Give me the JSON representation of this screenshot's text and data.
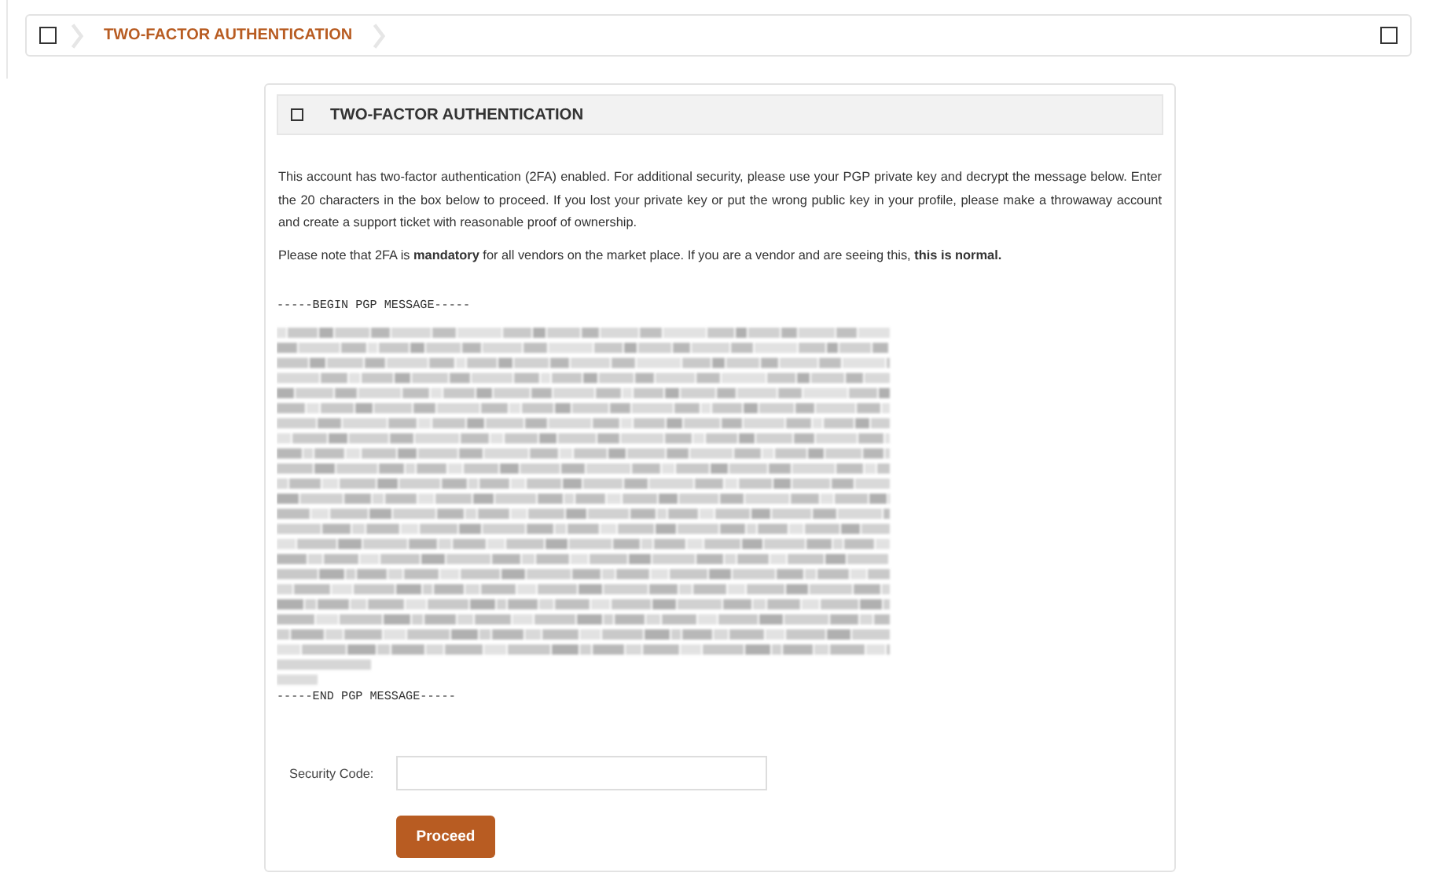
{
  "breadcrumb": {
    "items": [
      {
        "label": "TWO-FACTOR AUTHENTICATION",
        "selected": true
      }
    ]
  },
  "panel": {
    "title": "TWO-FACTOR AUTHENTICATION",
    "paragraphs": [
      "This account has two-factor authentication (2FA) enabled. For additional security, please use your PGP private key and decrypt the message below. Enter the 20 characters in the box below to proceed. If you lost your private key or put the wrong public key in your profile, please make a throwaway account and create a support ticket with reasonable proof of ownership.",
      "Please note that 2FA is **mandatory** for all vendors on the market place. If you are a vendor and are seeing this, **this is normal.**"
    ],
    "pgp_begin": "-----BEGIN PGP MESSAGE-----",
    "pgp_end": "-----END PGP MESSAGE-----",
    "security_code": {
      "label": "Security Code:"
    },
    "button": "Proceed"
  }
}
